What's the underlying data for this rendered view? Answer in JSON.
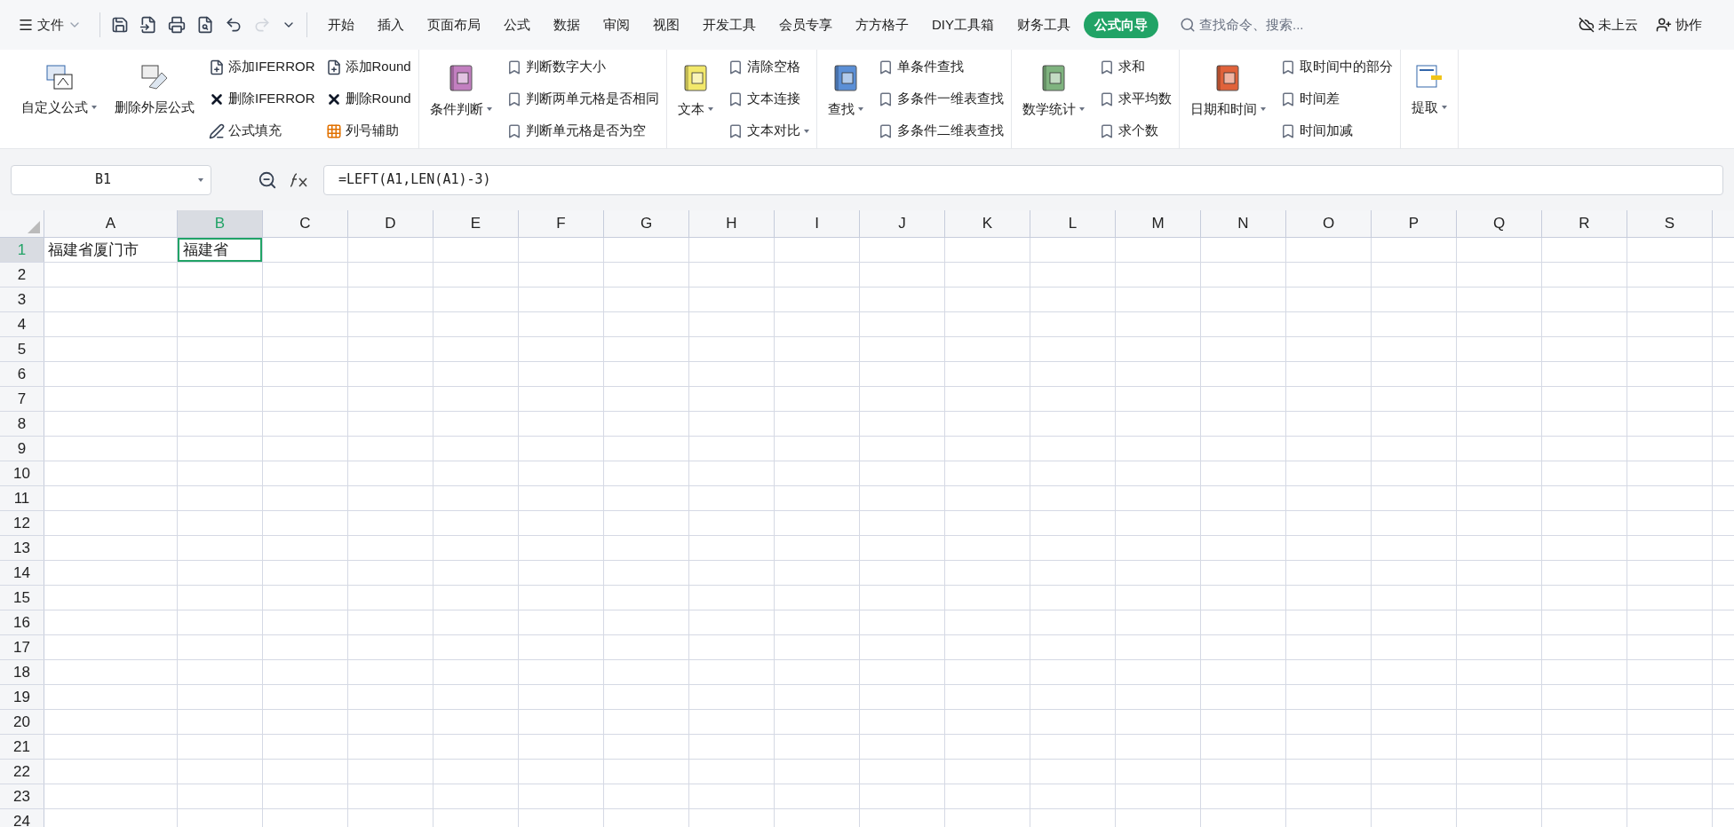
{
  "menu": {
    "label": "文件"
  },
  "tabs": [
    {
      "label": "开始",
      "selected": false
    },
    {
      "label": "插入",
      "selected": false
    },
    {
      "label": "页面布局",
      "selected": false
    },
    {
      "label": "公式",
      "selected": false
    },
    {
      "label": "数据",
      "selected": false
    },
    {
      "label": "审阅",
      "selected": false
    },
    {
      "label": "视图",
      "selected": false
    },
    {
      "label": "开发工具",
      "selected": false
    },
    {
      "label": "会员专享",
      "selected": false
    },
    {
      "label": "方方格子",
      "selected": false
    },
    {
      "label": "DIY工具箱",
      "selected": false
    },
    {
      "label": "财务工具",
      "selected": false
    },
    {
      "label": "公式向导",
      "selected": true
    }
  ],
  "search": {
    "placeholder": "查找命令、搜索..."
  },
  "account": [
    {
      "kind": "cloud",
      "label": "未上云"
    },
    {
      "kind": "share",
      "label": "协作"
    }
  ],
  "ribbon": [
    {
      "large": [
        {
          "label": "自定义公式",
          "kind": "custom",
          "dropdown": true
        },
        {
          "label": "删除外层公式",
          "kind": "erase",
          "dropdown": false
        }
      ],
      "columns": [
        [
          {
            "label": "添加IFERROR",
            "kind": "add",
            "dropdown": false
          },
          {
            "label": "删除IFERROR",
            "kind": "delete",
            "dropdown": false
          },
          {
            "label": "公式填充",
            "kind": "fill",
            "dropdown": false
          }
        ],
        [
          {
            "label": "添加Round",
            "kind": "add",
            "dropdown": false
          },
          {
            "label": "删除Round",
            "kind": "delete",
            "dropdown": false
          },
          {
            "label": "列号辅助",
            "kind": "grid",
            "dropdown": false
          }
        ]
      ]
    },
    {
      "large": [
        {
          "label": "条件判断",
          "kind": "book",
          "color": "#c27fc0",
          "dropdown": true
        }
      ],
      "columns": [
        [
          {
            "label": "判断数字大小",
            "kind": "bookmark",
            "dropdown": false
          },
          {
            "label": "判断两单元格是否相同",
            "kind": "bookmark",
            "dropdown": false
          },
          {
            "label": "判断单元格是否为空",
            "kind": "bookmark",
            "dropdown": false
          }
        ]
      ]
    },
    {
      "large": [
        {
          "label": "文本",
          "kind": "book",
          "color": "#f2e86a",
          "dropdown": true
        }
      ],
      "columns": [
        [
          {
            "label": "清除空格",
            "kind": "bookmark",
            "dropdown": false
          },
          {
            "label": "文本连接",
            "kind": "bookmark",
            "dropdown": false
          },
          {
            "label": "文本对比",
            "kind": "bookmark",
            "dropdown": true
          }
        ]
      ]
    },
    {
      "large": [
        {
          "label": "查找",
          "kind": "book",
          "color": "#5b8fd6",
          "dropdown": true
        }
      ],
      "columns": [
        [
          {
            "label": "单条件查找",
            "kind": "bookmark",
            "dropdown": false
          },
          {
            "label": "多条件一维表查找",
            "kind": "bookmark",
            "dropdown": false
          },
          {
            "label": "多条件二维表查找",
            "kind": "bookmark",
            "dropdown": false
          }
        ]
      ]
    },
    {
      "large": [
        {
          "label": "数学统计",
          "kind": "book",
          "color": "#7fb37f",
          "dropdown": true
        }
      ],
      "columns": [
        [
          {
            "label": "求和",
            "kind": "bookmark",
            "dropdown": false
          },
          {
            "label": "求平均数",
            "kind": "bookmark",
            "dropdown": false
          },
          {
            "label": "求个数",
            "kind": "bookmark",
            "dropdown": false
          }
        ]
      ]
    },
    {
      "large": [
        {
          "label": "日期和时间",
          "kind": "book",
          "color": "#e0623a",
          "dropdown": true
        }
      ],
      "columns": [
        [
          {
            "label": "取时间中的部分",
            "kind": "bookmark",
            "dropdown": false
          },
          {
            "label": "时间差",
            "kind": "bookmark",
            "dropdown": false
          },
          {
            "label": "时间加减",
            "kind": "bookmark",
            "dropdown": false
          }
        ]
      ]
    },
    {
      "large": [
        {
          "label": "提取",
          "kind": "extract",
          "dropdown": true
        }
      ]
    }
  ],
  "formula_bar": {
    "name_box": "B1",
    "formula": "=LEFT(A1,LEN(A1)-3)"
  },
  "sheet": {
    "columns": [
      {
        "label": "A",
        "selected": false
      },
      {
        "label": "B",
        "selected": true
      },
      {
        "label": "C",
        "selected": false
      },
      {
        "label": "D",
        "selected": false
      },
      {
        "label": "E",
        "selected": false
      },
      {
        "label": "F",
        "selected": false
      },
      {
        "label": "G",
        "selected": false
      },
      {
        "label": "H",
        "selected": false
      },
      {
        "label": "I",
        "selected": false
      },
      {
        "label": "J",
        "selected": false
      },
      {
        "label": "K",
        "selected": false
      },
      {
        "label": "L",
        "selected": false
      },
      {
        "label": "M",
        "selected": false
      },
      {
        "label": "N",
        "selected": false
      },
      {
        "label": "O",
        "selected": false
      },
      {
        "label": "P",
        "selected": false
      },
      {
        "label": "Q",
        "selected": false
      },
      {
        "label": "R",
        "selected": false
      },
      {
        "label": "S",
        "selected": false
      }
    ],
    "rows": [
      {
        "label": "1",
        "selected": true,
        "cells": [
          {
            "text": "福建省厦门市",
            "selected": false
          },
          {
            "text": "福建省",
            "selected": true
          }
        ]
      },
      {
        "label": "2",
        "selected": false
      },
      {
        "label": "3",
        "selected": false
      },
      {
        "label": "4",
        "selected": false
      },
      {
        "label": "5",
        "selected": false
      },
      {
        "label": "6",
        "selected": false
      },
      {
        "label": "7",
        "selected": false
      },
      {
        "label": "8",
        "selected": false
      },
      {
        "label": "9",
        "selected": false
      },
      {
        "label": "10",
        "selected": false
      },
      {
        "label": "11",
        "selected": false
      },
      {
        "label": "12",
        "selected": false
      },
      {
        "label": "13",
        "selected": false
      },
      {
        "label": "14",
        "selected": false
      },
      {
        "label": "15",
        "selected": false
      },
      {
        "label": "16",
        "selected": false
      },
      {
        "label": "17",
        "selected": false
      },
      {
        "label": "18",
        "selected": false
      },
      {
        "label": "19",
        "selected": false
      },
      {
        "label": "20",
        "selected": false
      },
      {
        "label": "21",
        "selected": false
      },
      {
        "label": "22",
        "selected": false
      },
      {
        "label": "23",
        "selected": false
      },
      {
        "label": "24",
        "selected": false
      }
    ]
  }
}
